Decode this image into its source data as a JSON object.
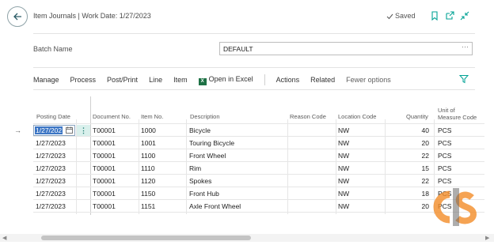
{
  "header": {
    "title": "Item Journals | Work Date: 1/27/2023",
    "saved_label": "Saved"
  },
  "batch": {
    "label": "Batch Name",
    "value": "DEFAULT",
    "lookup": "···"
  },
  "actions": {
    "manage": "Manage",
    "process": "Process",
    "post_print": "Post/Print",
    "line": "Line",
    "item": "Item",
    "open_in_excel": "Open in Excel",
    "actions": "Actions",
    "related": "Related",
    "fewer_options": "Fewer options"
  },
  "columns": {
    "posting_date": "Posting Date",
    "document_no": "Document No.",
    "item_no": "Item No.",
    "description": "Description",
    "reason_code": "Reason Code",
    "location_code": "Location Code",
    "quantity": "Quantity",
    "unit_line1": "Unit of",
    "unit_line2": "Measure Code"
  },
  "rows": [
    {
      "date": "1/27/2023",
      "doc": "T00001",
      "item": "1000",
      "desc": "Bicycle",
      "reason": "",
      "loc": "NW",
      "qty": "40",
      "uom": "PCS"
    },
    {
      "date": "1/27/2023",
      "doc": "T00001",
      "item": "1001",
      "desc": "Touring Bicycle",
      "reason": "",
      "loc": "NW",
      "qty": "20",
      "uom": "PCS"
    },
    {
      "date": "1/27/2023",
      "doc": "T00001",
      "item": "1100",
      "desc": "Front Wheel",
      "reason": "",
      "loc": "NW",
      "qty": "22",
      "uom": "PCS"
    },
    {
      "date": "1/27/2023",
      "doc": "T00001",
      "item": "1110",
      "desc": "Rim",
      "reason": "",
      "loc": "NW",
      "qty": "15",
      "uom": "PCS"
    },
    {
      "date": "1/27/2023",
      "doc": "T00001",
      "item": "1120",
      "desc": "Spokes",
      "reason": "",
      "loc": "NW",
      "qty": "22",
      "uom": "PCS"
    },
    {
      "date": "1/27/2023",
      "doc": "T00001",
      "item": "1150",
      "desc": "Front Hub",
      "reason": "",
      "loc": "NW",
      "qty": "18",
      "uom": "PCS"
    },
    {
      "date": "1/27/2023",
      "doc": "T00001",
      "item": "1151",
      "desc": "Axle Front Wheel",
      "reason": "",
      "loc": "NW",
      "qty": "20",
      "uom": "PCS"
    }
  ],
  "selected_date_display": "1/27/202",
  "icons": {
    "back": "arrow-left-icon",
    "saved": "checkmark-icon",
    "bookmark": "bookmark-icon",
    "open_new": "open-in-new-window-icon",
    "collapse": "collapse-icon",
    "excel": "excel-icon",
    "filter": "filter-icon",
    "calendar": "calendar-icon",
    "row_menu": "kebab-icon",
    "selected_row": "arrow-right-icon"
  },
  "colors": {
    "accent": "#00a294",
    "selection": "#3b75c4",
    "watermark_orange": "#f28c28"
  }
}
